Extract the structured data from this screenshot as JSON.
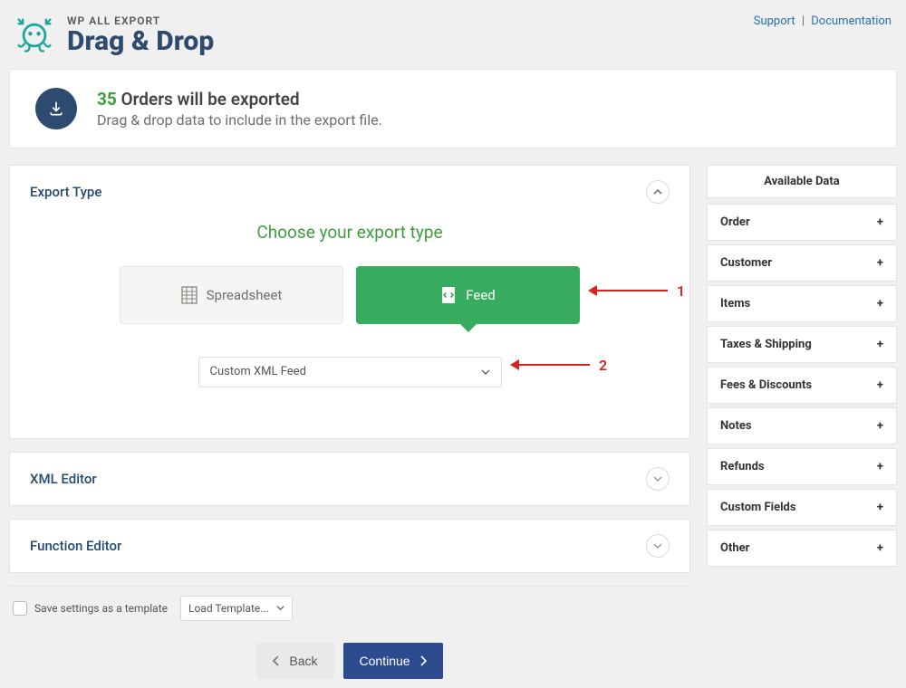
{
  "header": {
    "app_name": "WP ALL EXPORT",
    "page_title": "Drag & Drop",
    "support": "Support",
    "documentation": "Documentation"
  },
  "summary": {
    "count": "35",
    "orders_exported": "Orders will be exported",
    "subtitle": "Drag & drop data to include in the export file."
  },
  "export_type": {
    "panel_title": "Export Type",
    "choose_title": "Choose your export type",
    "spreadsheet_label": "Spreadsheet",
    "feed_label": "Feed",
    "select_value": "Custom XML Feed"
  },
  "annotations": {
    "one": "1",
    "two": "2"
  },
  "xml_editor": {
    "title": "XML Editor"
  },
  "function_editor": {
    "title": "Function Editor"
  },
  "save_row": {
    "checkbox_label": "Save settings as a template",
    "load_template": "Load Template..."
  },
  "nav": {
    "back": "Back",
    "continue": "Continue"
  },
  "sidebar": {
    "title": "Available Data",
    "items": [
      {
        "label": "Order"
      },
      {
        "label": "Customer"
      },
      {
        "label": "Items"
      },
      {
        "label": "Taxes & Shipping"
      },
      {
        "label": "Fees & Discounts"
      },
      {
        "label": "Notes"
      },
      {
        "label": "Refunds"
      },
      {
        "label": "Custom Fields"
      },
      {
        "label": "Other"
      }
    ]
  }
}
